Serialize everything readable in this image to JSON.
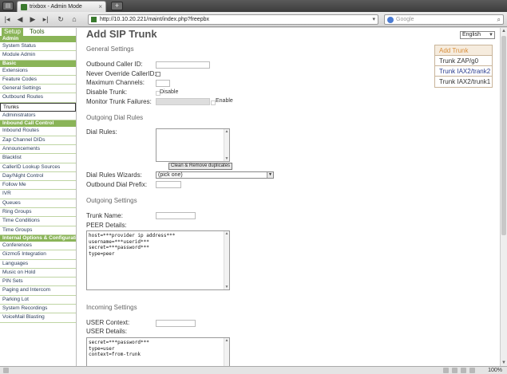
{
  "browser": {
    "tab_title": "trixbox - Admin Mode",
    "tab_close": "×",
    "new_tab": "+",
    "url": "http://10.10.20.221/maint/index.php?freepbx",
    "search_placeholder": "Google",
    "zoom": "100%"
  },
  "sidebar": {
    "tabs": [
      "Setup",
      "Tools"
    ],
    "groups": [
      {
        "title": "Admin",
        "items": [
          "System Status",
          "Module Admin"
        ]
      },
      {
        "title": "Basic",
        "items": [
          "Extensions",
          "Feature Codes",
          "General Settings",
          "Outbound Routes",
          "Trunks",
          "Administrators"
        ]
      },
      {
        "title": "Inbound Call Control",
        "items": [
          "Inbound Routes",
          "Zap Channel DIDs",
          "Announcements",
          "Blacklist",
          "CallerID Lookup Sources",
          "Day/Night Control",
          "Follow Me",
          "IVR",
          "Queues",
          "Ring Groups",
          "Time Conditions",
          "Time Groups"
        ]
      },
      {
        "title": "Internal Options & Configuration",
        "items": [
          "Conferences",
          "Gizmo5 Integration",
          "Languages",
          "Music on Hold",
          "PIN Sets",
          "Paging and Intercom",
          "Parking Lot",
          "System Recordings",
          "VoiceMail Blasting"
        ]
      }
    ],
    "selected": "Trunks"
  },
  "main": {
    "title": "Add SIP Trunk",
    "language": "English",
    "general": {
      "heading": "General Settings",
      "outbound_caller_id": "Outbound Caller ID:",
      "never_override": "Never Override CallerID:",
      "max_channels": "Maximum Channels:",
      "disable_trunk": "Disable Trunk:",
      "disable_label": "Disable",
      "monitor_failures": "Monitor Trunk Failures:",
      "enable_label": "Enable"
    },
    "dial_rules": {
      "heading": "Outgoing Dial Rules",
      "dial_rules_label": "Dial Rules:",
      "clean_button": "Clean & Remove duplicates",
      "wizards_label": "Dial Rules Wizards:",
      "wizards_value": "(pick one)",
      "outbound_prefix": "Outbound Dial Prefix:"
    },
    "outgoing": {
      "heading": "Outgoing Settings",
      "trunk_name": "Trunk Name:",
      "peer_details_label": "PEER Details:",
      "peer_details": "host=***provider ip address***\nusername=***userid***\nsecret=***password***\ntype=peer"
    },
    "incoming": {
      "heading": "Incoming Settings",
      "user_context": "USER Context:",
      "user_details_label": "USER Details:",
      "user_details": "secret=***password***\ntype=user\ncontext=from-trunk"
    }
  },
  "trunks_panel": {
    "add": "Add Trunk",
    "items": [
      "Trunk ZAP/g0",
      "Trunk IAX2/trank2",
      "Trunk IAX2/trunk1"
    ]
  },
  "colors": {
    "sidebar_green": "#8ab458",
    "add_trunk_orange": "#d98e3a",
    "link_blue": "#2a3d8f"
  }
}
